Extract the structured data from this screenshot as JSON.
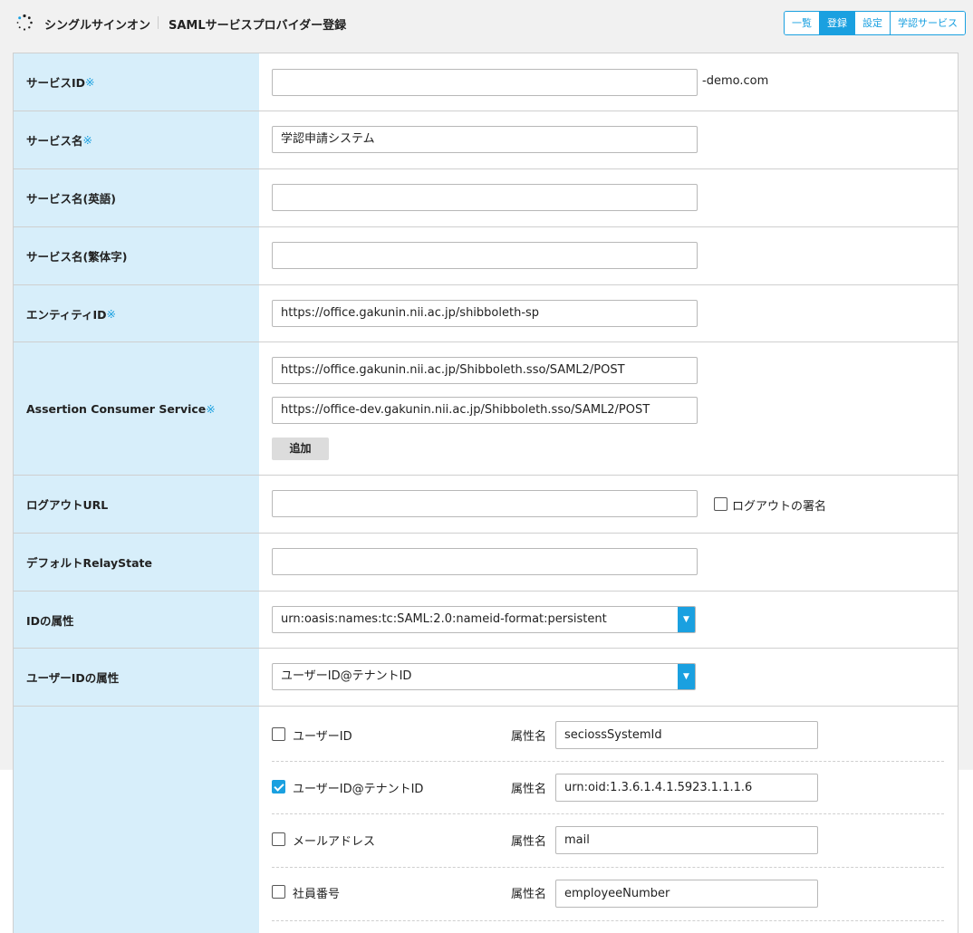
{
  "header": {
    "app_title": "シングルサインオン",
    "page_title": "SAMLサービスプロバイダー登録",
    "tabs": [
      {
        "label": "一覧",
        "active": false
      },
      {
        "label": "登録",
        "active": true
      },
      {
        "label": "設定",
        "active": false
      },
      {
        "label": "学認サービス",
        "active": false
      }
    ]
  },
  "required_mark": "※",
  "fields": {
    "service_id": {
      "label": "サービスID",
      "value": "",
      "suffix": "-demo.com"
    },
    "service_name": {
      "label": "サービス名",
      "value": "学認申請システム"
    },
    "service_name_en": {
      "label": "サービス名(英語)",
      "value": ""
    },
    "service_name_tw": {
      "label": "サービス名(繁体字)",
      "value": ""
    },
    "entity_id": {
      "label": "エンティティID",
      "value": "https://office.gakunin.nii.ac.jp/shibboleth-sp"
    },
    "acs": {
      "label": "Assertion Consumer Service",
      "values": [
        "https://office.gakunin.nii.ac.jp/Shibboleth.sso/SAML2/POST",
        "https://office-dev.gakunin.nii.ac.jp/Shibboleth.sso/SAML2/POST"
      ],
      "add_label": "追加"
    },
    "logout_url": {
      "label": "ログアウトURL",
      "value": "",
      "sign_label": "ログアウトの署名",
      "sign_checked": false
    },
    "relay_state": {
      "label": "デフォルトRelayState",
      "value": ""
    },
    "id_attr": {
      "label": "IDの属性",
      "value": "urn:oasis:names:tc:SAML:2.0:nameid-format:persistent"
    },
    "user_id_attr": {
      "label": "ユーザーIDの属性",
      "value": "ユーザーID@テナントID"
    }
  },
  "attributes": {
    "attr_name_label": "属性名",
    "items": [
      {
        "label": "ユーザーID",
        "checked": false,
        "value": "seciossSystemId"
      },
      {
        "label": "ユーザーID@テナントID",
        "checked": true,
        "value": "urn:oid:1.3.6.1.4.1.5923.1.1.1.6"
      },
      {
        "label": "メールアドレス",
        "checked": false,
        "value": "mail"
      },
      {
        "label": "社員番号",
        "checked": false,
        "value": "employeeNumber"
      }
    ]
  },
  "icons": {
    "logo": "spinner-logo-icon",
    "dropdown": "chevron-down-icon"
  },
  "colors": {
    "accent": "#1aa0e0",
    "label_bg": "#d7eefa",
    "checked": "#1aa0e0"
  }
}
